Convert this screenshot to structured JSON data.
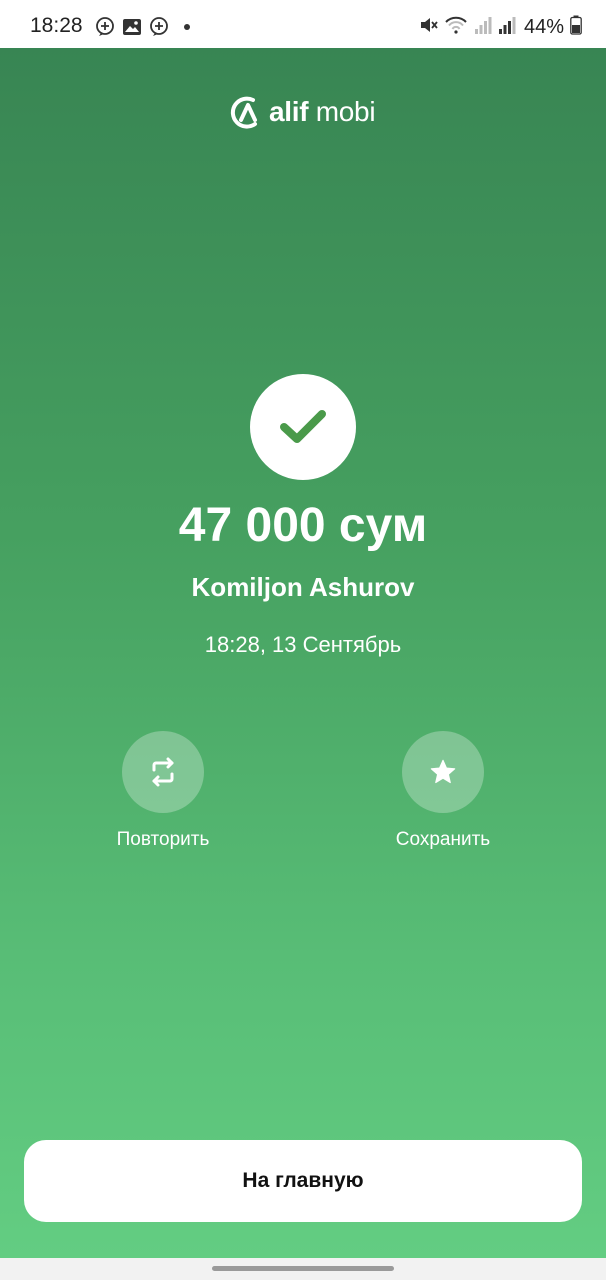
{
  "status_bar": {
    "time": "18:28",
    "battery": "44%",
    "notification_icons": [
      "messenger-icon",
      "gallery-icon",
      "messenger-icon",
      "dot"
    ],
    "system_icons": [
      "mute-icon",
      "wifi-icon",
      "signal-icon",
      "signal-icon",
      "battery-icon"
    ]
  },
  "logo": {
    "brand": "alif",
    "product": "mobi"
  },
  "receipt": {
    "status_icon": "checkmark-icon",
    "amount": "47 000 сум",
    "recipient": "Komiljon Ashurov",
    "datetime": "18:28, 13 Сентябрь"
  },
  "actions": {
    "repeat_label": "Повторить",
    "save_label": "Сохранить"
  },
  "home_button_label": "На главную",
  "colors": {
    "gradient_top": "#388553",
    "gradient_bottom": "#63cd82",
    "check": "#4a9a4a"
  }
}
